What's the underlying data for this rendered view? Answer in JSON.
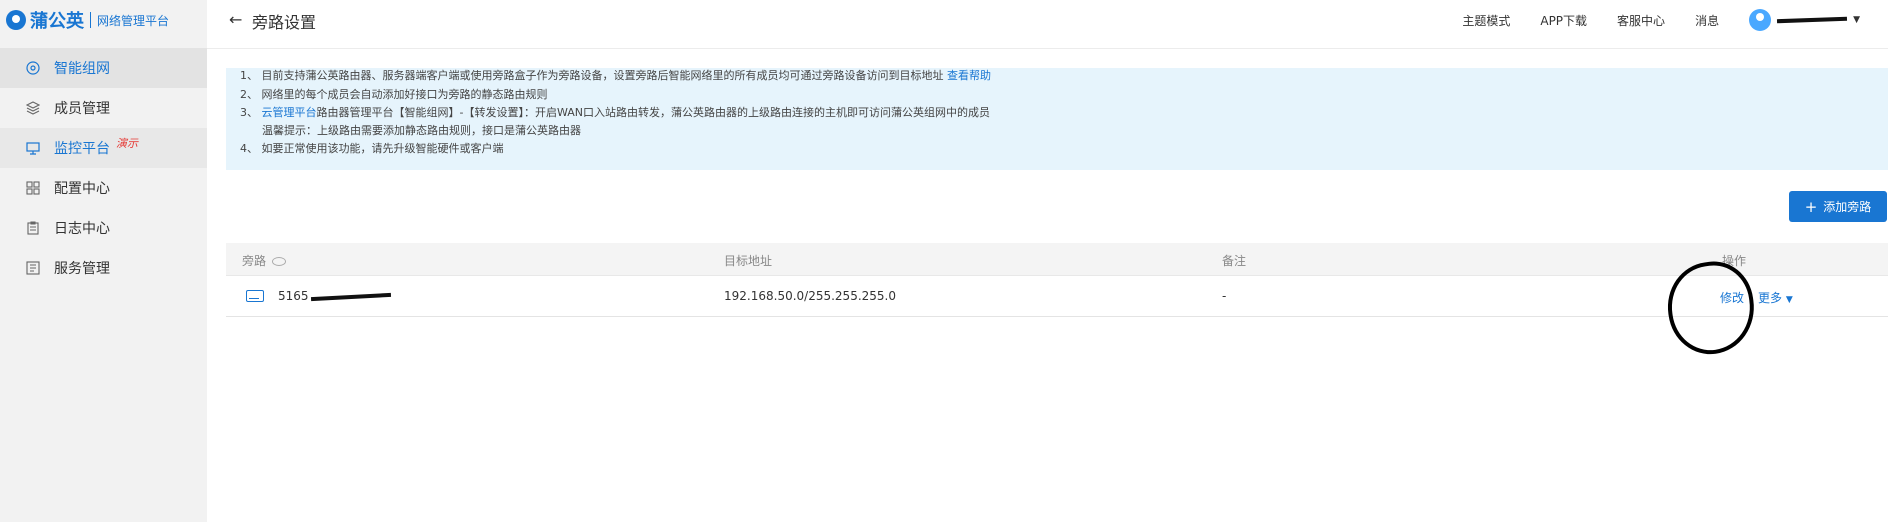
{
  "brand": {
    "name": "蒲公英",
    "subtitle": "网络管理平台"
  },
  "sidebar": {
    "items": [
      {
        "label": "智能组网",
        "icon": "network-icon"
      },
      {
        "label": "成员管理",
        "icon": "layers-icon"
      },
      {
        "label": "监控平台",
        "icon": "monitor-icon",
        "tag": "演示"
      },
      {
        "label": "配置中心",
        "icon": "grid-icon"
      },
      {
        "label": "日志中心",
        "icon": "clipboard-icon"
      },
      {
        "label": "服务管理",
        "icon": "list-icon"
      }
    ]
  },
  "header": {
    "back_icon": "←",
    "title": "旁路设置",
    "links": [
      "主题模式",
      "APP下载",
      "客服中心",
      "消息"
    ]
  },
  "notice": {
    "line1": "1、 目前支持蒲公英路由器、服务器端客户端或使用旁路盒子作为旁路设备，设置旁路后智能网络里的所有成员均可通过旁路设备访问到目标地址",
    "line1_link": "查看帮助",
    "line2": "2、 网络里的每个成员会自动添加好接口为旁路的静态路由规则",
    "line3_prefix": "3、",
    "line3_link": "云管理平台",
    "line3_text": "路由器管理平台【智能组网】-【转发设置】：开启WAN口入站路由转发，蒲公英路由器的上级路由连接的主机即可访问蒲公英组网中的成员",
    "line3_sub": "温馨提示：上级路由需要添加静态路由规则，接口是蒲公英路由器",
    "line4": "4、 如要正常使用该功能，请先升级智能硬件或客户端"
  },
  "add_button": {
    "label": "添加旁路"
  },
  "table": {
    "columns": [
      "旁路",
      "目标地址",
      "备注",
      "操作"
    ],
    "rows": [
      {
        "bypass": "5165",
        "target": "192.168.50.0/255.255.255.0",
        "remark": "-",
        "edit": "修改",
        "more": "更多"
      }
    ]
  },
  "colors": {
    "accent": "#1976d2",
    "notice_bg": "#e6f4fc",
    "sidebar_bg": "#f2f2f2"
  }
}
